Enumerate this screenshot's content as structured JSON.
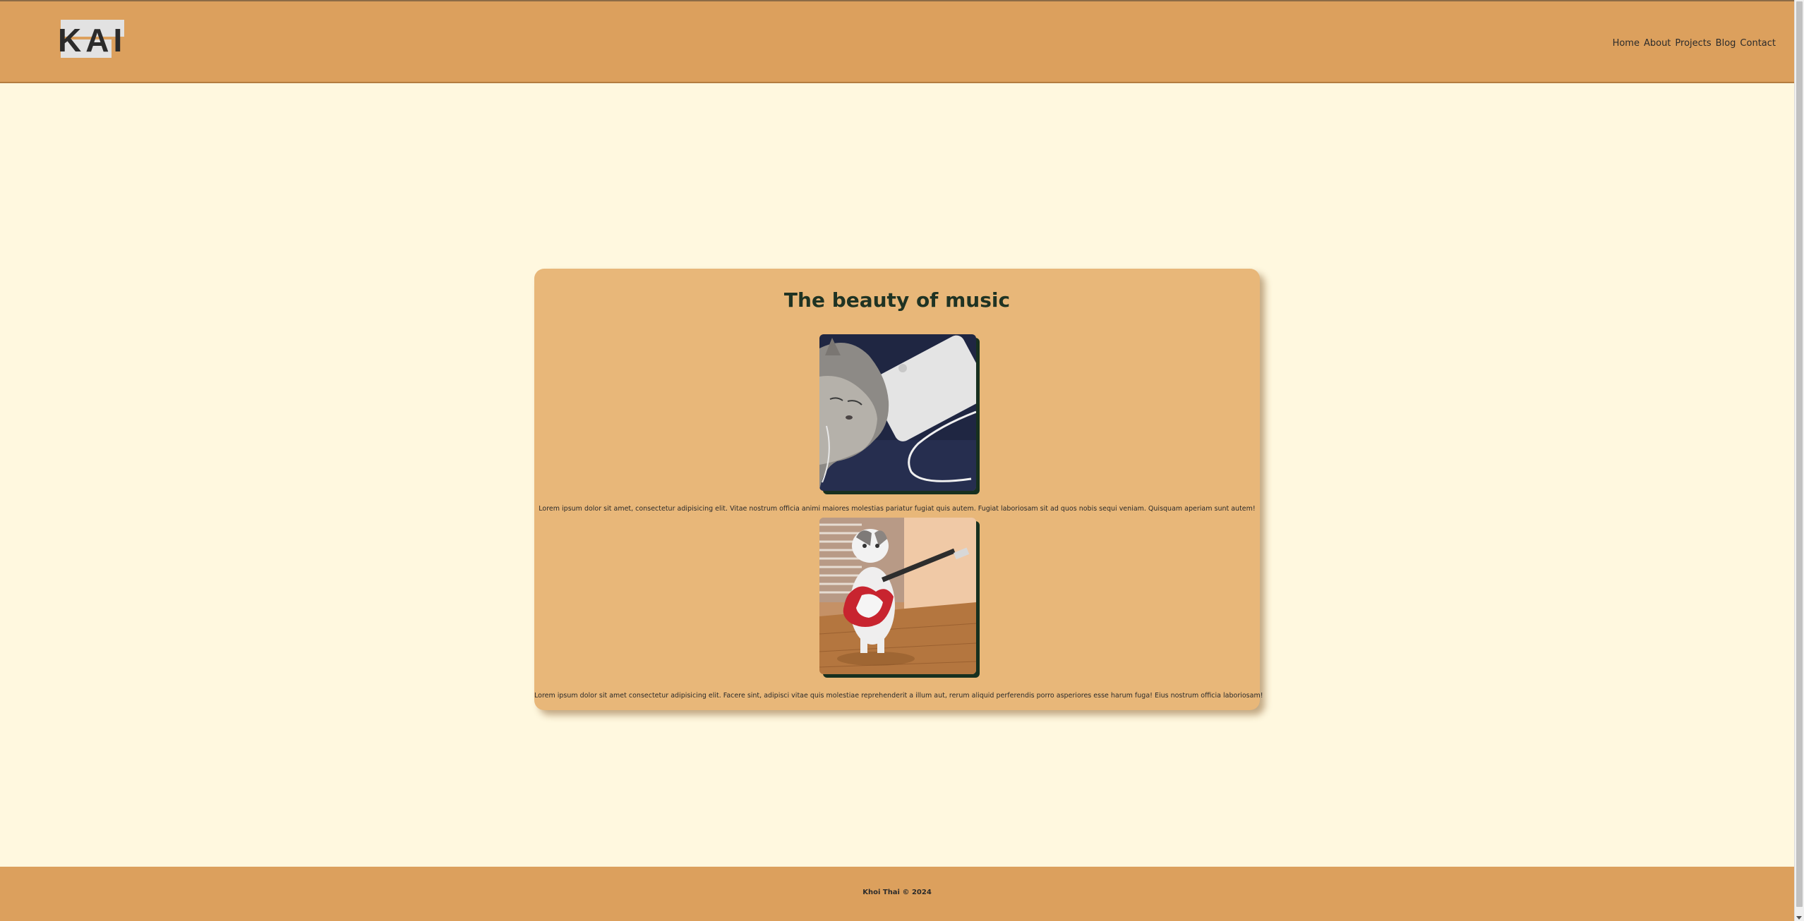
{
  "header": {
    "logo_text": "KAI",
    "nav": [
      {
        "label": "Home"
      },
      {
        "label": "About"
      },
      {
        "label": "Projects"
      },
      {
        "label": "Blog"
      },
      {
        "label": "Contact"
      }
    ]
  },
  "main": {
    "title": "The beauty of music",
    "items": [
      {
        "image_icon": "cat-with-earphones-photo",
        "caption": "Lorem ipsum dolor sit amet, consectetur adipisicing elit. Vitae nostrum officia animi maiores molestias pariatur fugiat quis autem. Fugiat laboriosam sit ad quos nobis sequi veniam. Quisquam aperiam sunt autem!"
      },
      {
        "image_icon": "cat-with-guitar-photo",
        "caption": "Lorem ipsum dolor sit amet consectetur adipisicing elit. Facere sint, adipisci vitae quis molestiae reprehenderit a illum aut, rerum aliquid perferendis porro asperiores esse harum fuga! Eius nostrum officia laboriosam!"
      }
    ]
  },
  "footer": {
    "text": "Khoi Thai © 2024"
  },
  "colors": {
    "header_bg": "#dca05d",
    "page_bg": "#fff8df",
    "card_bg": "#e8b779",
    "title": "#1f3323"
  }
}
